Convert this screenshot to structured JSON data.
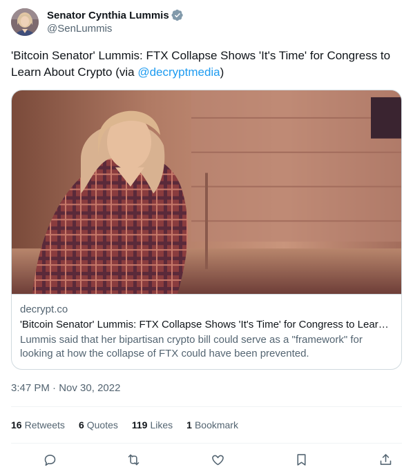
{
  "author": {
    "display_name": "Senator Cynthia Lummis",
    "handle": "@SenLummis",
    "verified": true,
    "verified_color": "#829aab"
  },
  "tweet": {
    "text_before": "'Bitcoin Senator' Lummis: FTX Collapse Shows 'It's Time' for Congress to Learn About Crypto (via ",
    "mention": "@decryptmedia",
    "text_after": ")"
  },
  "card": {
    "domain": "decrypt.co",
    "title": "'Bitcoin Senator' Lummis: FTX Collapse Shows 'It's Time' for Congress to Learn About Crypto",
    "description": "Lummis said that her bipartisan crypto bill could serve as a \"framework\" for looking at how the collapse of FTX could have been prevented."
  },
  "timestamp": {
    "time": "3:47 PM",
    "separator": " · ",
    "date": "Nov 30, 2022"
  },
  "stats": {
    "retweets_count": "16",
    "retweets_label": "Retweets",
    "quotes_count": "6",
    "quotes_label": "Quotes",
    "likes_count": "119",
    "likes_label": "Likes",
    "bookmarks_count": "1",
    "bookmarks_label": "Bookmark"
  },
  "actions": [
    "reply-icon",
    "retweet-icon",
    "like-icon",
    "bookmark-icon",
    "share-icon"
  ],
  "colors": {
    "link": "#1d9bf0",
    "secondary_text": "#536471",
    "border": "#cfd9de"
  }
}
